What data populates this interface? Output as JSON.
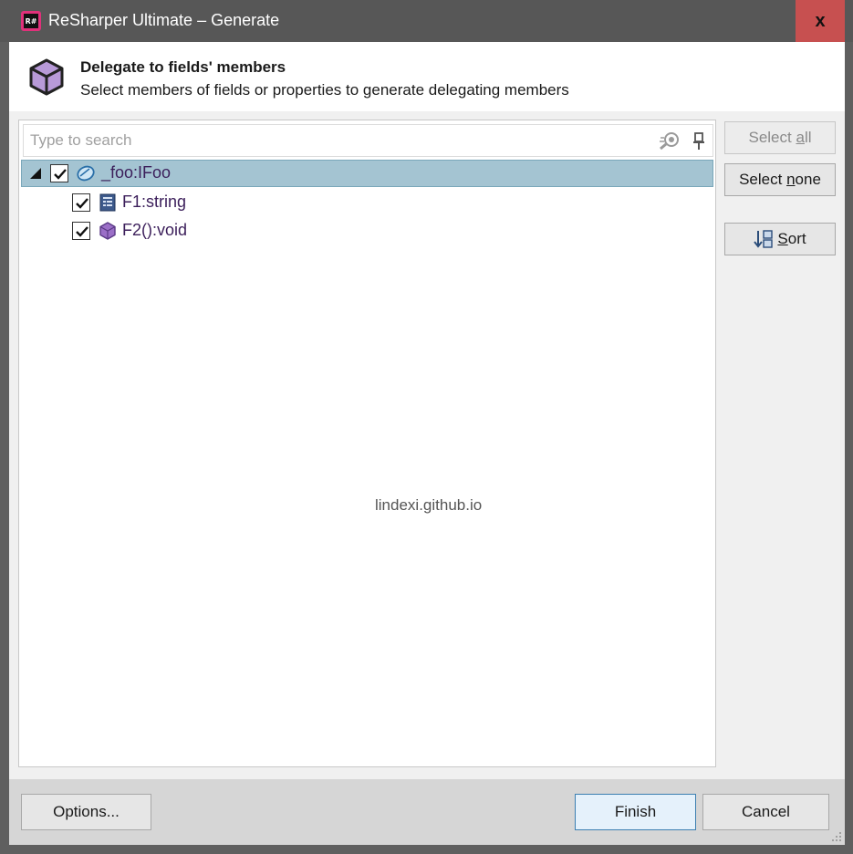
{
  "window": {
    "title": "ReSharper Ultimate – Generate",
    "close_label": "x"
  },
  "header": {
    "title": "Delegate to fields' members",
    "subtitle": "Select members of fields or properties to generate delegating members"
  },
  "search": {
    "placeholder": "Type to search",
    "value": ""
  },
  "tree": {
    "root": {
      "label": "_foo:IFoo",
      "checked": true,
      "expanded": true,
      "selected": true
    },
    "children": [
      {
        "label": "F1:string",
        "checked": true
      },
      {
        "label": "F2():void",
        "checked": true
      }
    ]
  },
  "watermark": "lindexi.github.io",
  "side_buttons": {
    "select_all_pre": "Select ",
    "select_all_ul": "a",
    "select_all_post": "ll",
    "select_none_pre": "Select ",
    "select_none_ul": "n",
    "select_none_post": "one",
    "sort_ul": "S",
    "sort_post": "ort"
  },
  "footer": {
    "options_label": "Options...",
    "finish_label": "Finish",
    "cancel_label": "Cancel"
  },
  "colors": {
    "titlebar": "#575757",
    "close": "#c75050",
    "selection": "#a4c4d2",
    "label_purple": "#3b1e5a",
    "icon_purple": "#9b6fc7"
  }
}
